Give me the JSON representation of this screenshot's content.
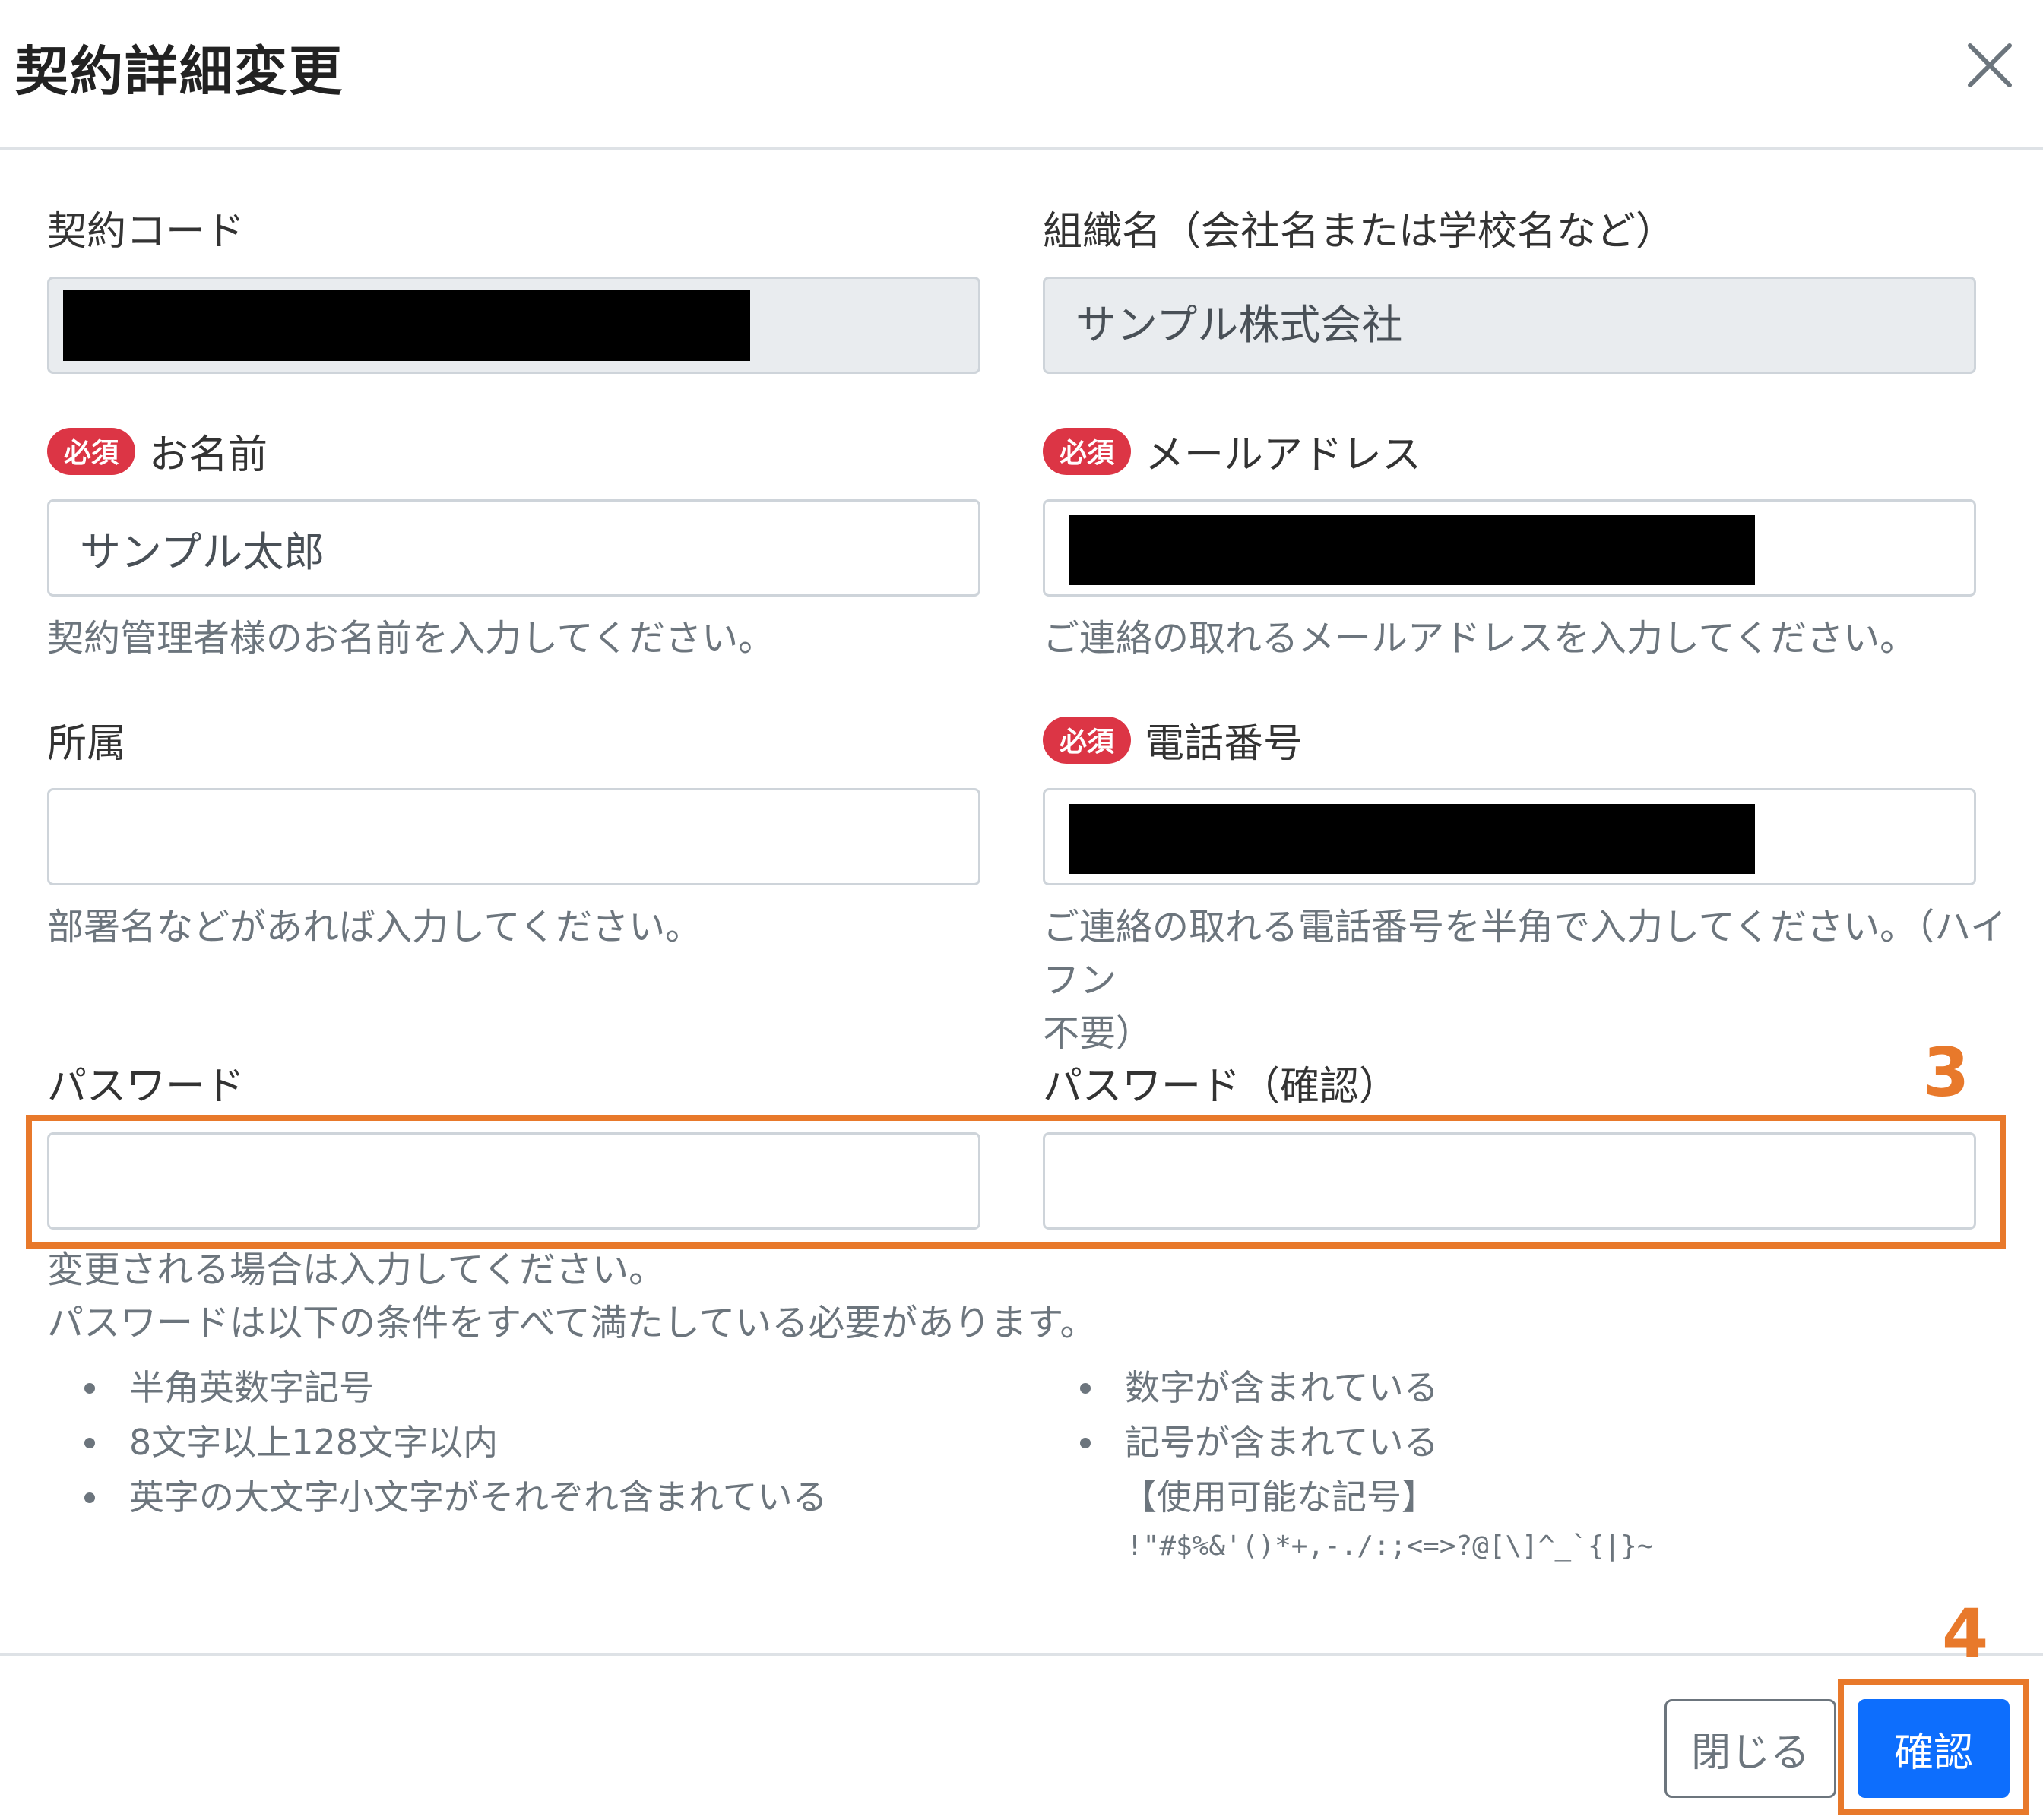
{
  "header": {
    "title": "契約詳細変更"
  },
  "fields": {
    "contract_code": {
      "label": "契約コード"
    },
    "org_name": {
      "label": "組織名（会社名または学校名など）",
      "value": "サンプル株式会社"
    },
    "name": {
      "badge": "必須",
      "label": "お名前",
      "value": "サンプル太郎",
      "help": "契約管理者様のお名前を入力してください。"
    },
    "email": {
      "badge": "必須",
      "label": "メールアドレス",
      "help": "ご連絡の取れるメールアドレスを入力してください。"
    },
    "department": {
      "label": "所属",
      "value": "",
      "help": "部署名などがあれば入力してください。"
    },
    "phone": {
      "badge": "必須",
      "label": "電話番号",
      "help_line1": "ご連絡の取れる電話番号を半角で入力してください。（ハイフン",
      "help_line2": "不要）"
    },
    "password": {
      "label": "パスワード",
      "value": ""
    },
    "password_confirm": {
      "label": "パスワード（確認）",
      "value": ""
    }
  },
  "password_help": {
    "line1": "変更される場合は入力してください。",
    "line2": "パスワードは以下の条件をすべて満たしている必要があります。",
    "rules_left": [
      "半角英数字記号",
      "8文字以上128文字以内",
      "英字の大文字小文字がそれぞれ含まれている"
    ],
    "rules_right": [
      "数字が含まれている",
      "記号が含まれている"
    ],
    "symbols_title": "【使用可能な記号】",
    "symbols": "!\"#$%&'()*+,-./:;<=>?@[\\]^_`{|}~"
  },
  "annotations": {
    "step3": "3",
    "step4": "4"
  },
  "footer": {
    "close_label": "閉じる",
    "confirm_label": "確認"
  },
  "colors": {
    "required_badge": "#dc3545",
    "primary": "#0d6efd",
    "highlight": "#e8792b"
  },
  "icons": {
    "close": "close-icon"
  }
}
